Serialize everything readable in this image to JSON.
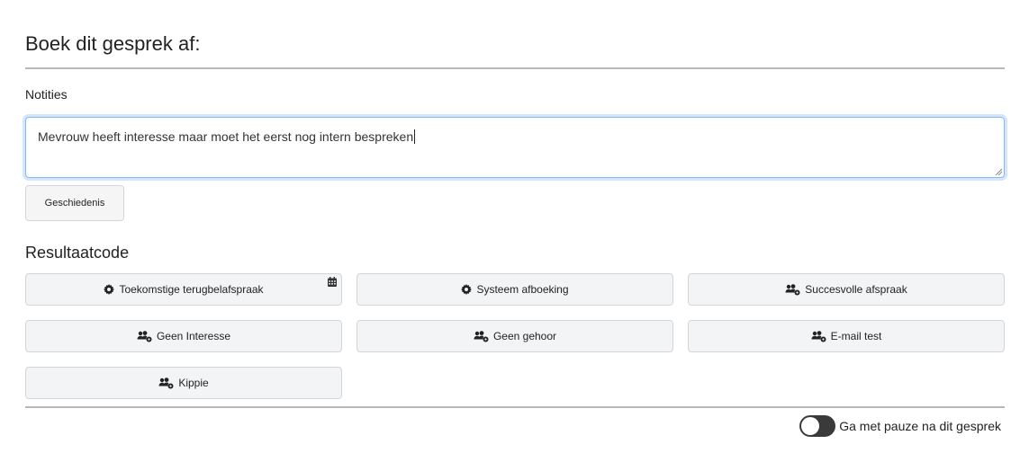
{
  "modal": {
    "title": "Boek dit gesprek af:"
  },
  "notes": {
    "label": "Notities",
    "value": "Mevrouw heeft interesse maar moet het eerst nog intern bespreken"
  },
  "history_button": {
    "label": "Geschiedenis"
  },
  "result_codes": {
    "title": "Resultaatcode",
    "items": [
      {
        "label": "Toekomstige terugbelafspraak",
        "icon": "gear-icon",
        "extra_icon": "calendar-icon"
      },
      {
        "label": "Systeem afboeking",
        "icon": "gear-icon"
      },
      {
        "label": "Succesvolle afspraak",
        "icon": "users-gear-icon"
      },
      {
        "label": "Geen Interesse",
        "icon": "users-gear-icon"
      },
      {
        "label": "Geen gehoor",
        "icon": "users-gear-icon"
      },
      {
        "label": "E-mail test",
        "icon": "users-gear-icon"
      },
      {
        "label": "Kippie",
        "icon": "users-gear-icon"
      }
    ]
  },
  "pause_toggle": {
    "label": "Ga met pauze na dit gesprek",
    "checked": false
  }
}
